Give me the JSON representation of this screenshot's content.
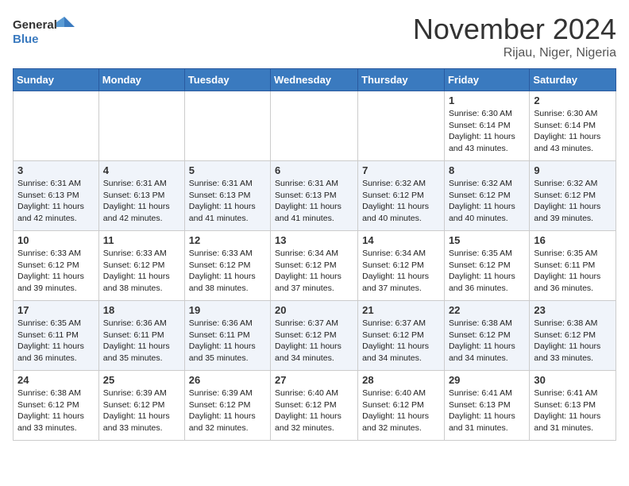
{
  "header": {
    "logo_general": "General",
    "logo_blue": "Blue",
    "month": "November 2024",
    "location": "Rijau, Niger, Nigeria"
  },
  "weekdays": [
    "Sunday",
    "Monday",
    "Tuesday",
    "Wednesday",
    "Thursday",
    "Friday",
    "Saturday"
  ],
  "weeks": [
    [
      {
        "day": "",
        "info": ""
      },
      {
        "day": "",
        "info": ""
      },
      {
        "day": "",
        "info": ""
      },
      {
        "day": "",
        "info": ""
      },
      {
        "day": "",
        "info": ""
      },
      {
        "day": "1",
        "info": "Sunrise: 6:30 AM\nSunset: 6:14 PM\nDaylight: 11 hours\nand 43 minutes."
      },
      {
        "day": "2",
        "info": "Sunrise: 6:30 AM\nSunset: 6:14 PM\nDaylight: 11 hours\nand 43 minutes."
      }
    ],
    [
      {
        "day": "3",
        "info": "Sunrise: 6:31 AM\nSunset: 6:13 PM\nDaylight: 11 hours\nand 42 minutes."
      },
      {
        "day": "4",
        "info": "Sunrise: 6:31 AM\nSunset: 6:13 PM\nDaylight: 11 hours\nand 42 minutes."
      },
      {
        "day": "5",
        "info": "Sunrise: 6:31 AM\nSunset: 6:13 PM\nDaylight: 11 hours\nand 41 minutes."
      },
      {
        "day": "6",
        "info": "Sunrise: 6:31 AM\nSunset: 6:13 PM\nDaylight: 11 hours\nand 41 minutes."
      },
      {
        "day": "7",
        "info": "Sunrise: 6:32 AM\nSunset: 6:12 PM\nDaylight: 11 hours\nand 40 minutes."
      },
      {
        "day": "8",
        "info": "Sunrise: 6:32 AM\nSunset: 6:12 PM\nDaylight: 11 hours\nand 40 minutes."
      },
      {
        "day": "9",
        "info": "Sunrise: 6:32 AM\nSunset: 6:12 PM\nDaylight: 11 hours\nand 39 minutes."
      }
    ],
    [
      {
        "day": "10",
        "info": "Sunrise: 6:33 AM\nSunset: 6:12 PM\nDaylight: 11 hours\nand 39 minutes."
      },
      {
        "day": "11",
        "info": "Sunrise: 6:33 AM\nSunset: 6:12 PM\nDaylight: 11 hours\nand 38 minutes."
      },
      {
        "day": "12",
        "info": "Sunrise: 6:33 AM\nSunset: 6:12 PM\nDaylight: 11 hours\nand 38 minutes."
      },
      {
        "day": "13",
        "info": "Sunrise: 6:34 AM\nSunset: 6:12 PM\nDaylight: 11 hours\nand 37 minutes."
      },
      {
        "day": "14",
        "info": "Sunrise: 6:34 AM\nSunset: 6:12 PM\nDaylight: 11 hours\nand 37 minutes."
      },
      {
        "day": "15",
        "info": "Sunrise: 6:35 AM\nSunset: 6:12 PM\nDaylight: 11 hours\nand 36 minutes."
      },
      {
        "day": "16",
        "info": "Sunrise: 6:35 AM\nSunset: 6:11 PM\nDaylight: 11 hours\nand 36 minutes."
      }
    ],
    [
      {
        "day": "17",
        "info": "Sunrise: 6:35 AM\nSunset: 6:11 PM\nDaylight: 11 hours\nand 36 minutes."
      },
      {
        "day": "18",
        "info": "Sunrise: 6:36 AM\nSunset: 6:11 PM\nDaylight: 11 hours\nand 35 minutes."
      },
      {
        "day": "19",
        "info": "Sunrise: 6:36 AM\nSunset: 6:11 PM\nDaylight: 11 hours\nand 35 minutes."
      },
      {
        "day": "20",
        "info": "Sunrise: 6:37 AM\nSunset: 6:12 PM\nDaylight: 11 hours\nand 34 minutes."
      },
      {
        "day": "21",
        "info": "Sunrise: 6:37 AM\nSunset: 6:12 PM\nDaylight: 11 hours\nand 34 minutes."
      },
      {
        "day": "22",
        "info": "Sunrise: 6:38 AM\nSunset: 6:12 PM\nDaylight: 11 hours\nand 34 minutes."
      },
      {
        "day": "23",
        "info": "Sunrise: 6:38 AM\nSunset: 6:12 PM\nDaylight: 11 hours\nand 33 minutes."
      }
    ],
    [
      {
        "day": "24",
        "info": "Sunrise: 6:38 AM\nSunset: 6:12 PM\nDaylight: 11 hours\nand 33 minutes."
      },
      {
        "day": "25",
        "info": "Sunrise: 6:39 AM\nSunset: 6:12 PM\nDaylight: 11 hours\nand 33 minutes."
      },
      {
        "day": "26",
        "info": "Sunrise: 6:39 AM\nSunset: 6:12 PM\nDaylight: 11 hours\nand 32 minutes."
      },
      {
        "day": "27",
        "info": "Sunrise: 6:40 AM\nSunset: 6:12 PM\nDaylight: 11 hours\nand 32 minutes."
      },
      {
        "day": "28",
        "info": "Sunrise: 6:40 AM\nSunset: 6:12 PM\nDaylight: 11 hours\nand 32 minutes."
      },
      {
        "day": "29",
        "info": "Sunrise: 6:41 AM\nSunset: 6:13 PM\nDaylight: 11 hours\nand 31 minutes."
      },
      {
        "day": "30",
        "info": "Sunrise: 6:41 AM\nSunset: 6:13 PM\nDaylight: 11 hours\nand 31 minutes."
      }
    ]
  ]
}
